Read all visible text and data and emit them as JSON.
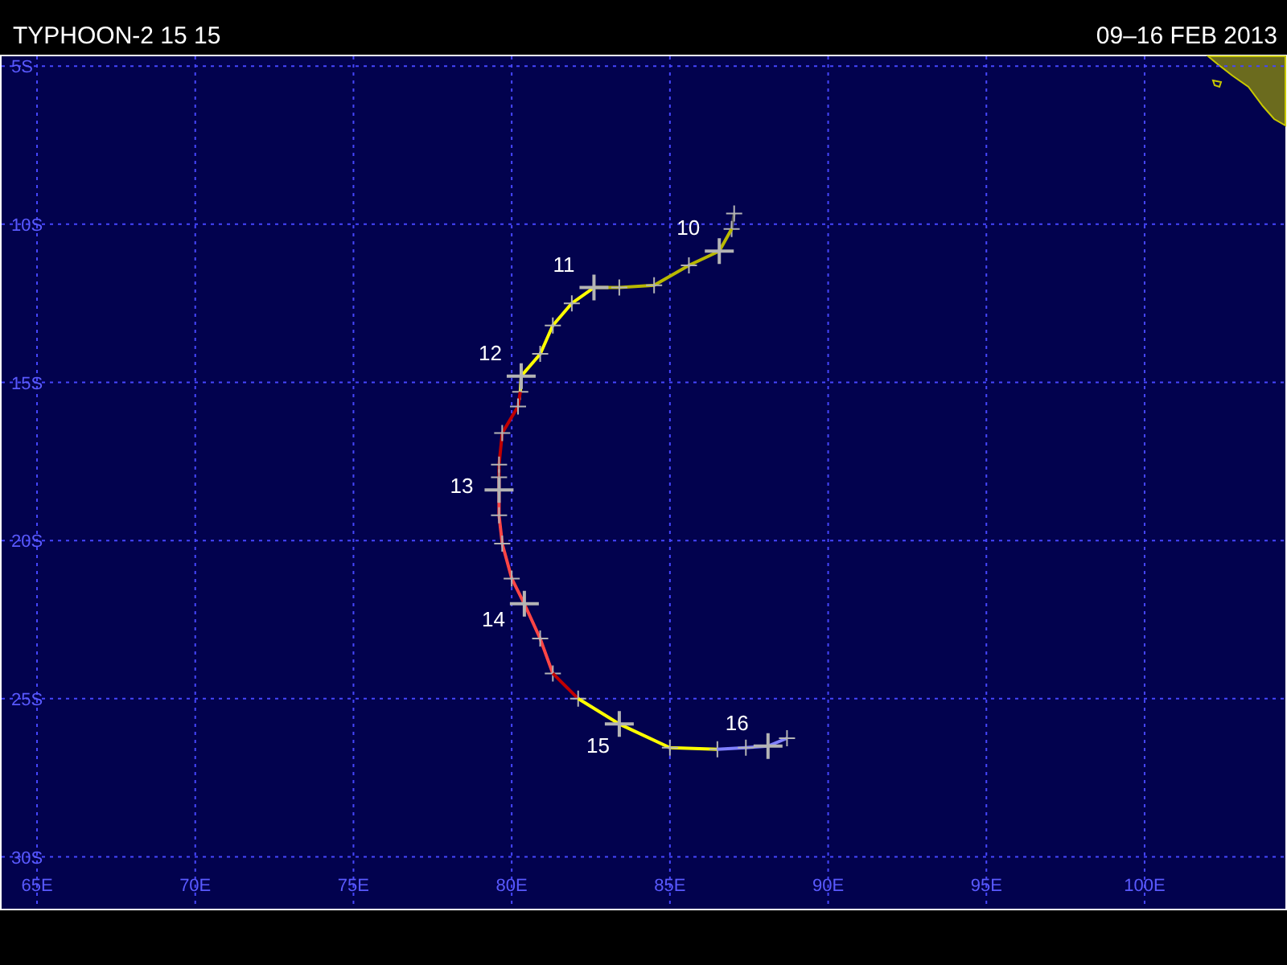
{
  "header": {
    "title": "TYPHOON-2 15 15",
    "date_range": "09–16 FEB 2013"
  },
  "map": {
    "chart_data": {
      "type": "line",
      "grid": true,
      "xlim": [
        63.83,
        104.5
      ],
      "ylim": [
        -31.69,
        -4.64
      ],
      "xticks": [
        {
          "value": 65,
          "label": "65E"
        },
        {
          "value": 70,
          "label": "70E"
        },
        {
          "value": 75,
          "label": "75E"
        },
        {
          "value": 80,
          "label": "80E"
        },
        {
          "value": 85,
          "label": "85E"
        },
        {
          "value": 90,
          "label": "90E"
        },
        {
          "value": 95,
          "label": "95E"
        },
        {
          "value": 100,
          "label": "100E"
        }
      ],
      "yticks": [
        {
          "value": -5,
          "label": "5S"
        },
        {
          "value": -10,
          "label": "10S"
        },
        {
          "value": -15,
          "label": "15S"
        },
        {
          "value": -20,
          "label": "20S"
        },
        {
          "value": -25,
          "label": "25S"
        },
        {
          "value": -30,
          "label": "30S"
        }
      ],
      "series": [
        {
          "color": "#505050",
          "marker": "cross",
          "x": [
            87.03,
            86.95
          ],
          "values": [
            -9.66,
            -10.15
          ]
        },
        {
          "color": "#b8b800",
          "marker": "cross",
          "x": [
            86.95,
            86.56,
            85.6,
            84.5,
            83.4,
            82.6
          ],
          "values": [
            -10.15,
            -10.85,
            -11.3,
            -11.93,
            -12.0,
            -12.0
          ]
        },
        {
          "color": "#ffff00",
          "marker": "cross",
          "x": [
            82.6,
            81.9,
            81.3,
            80.9,
            80.3,
            80.27
          ],
          "values": [
            -12.0,
            -12.5,
            -13.2,
            -14.1,
            -14.8,
            -15.3
          ]
        },
        {
          "color": "#c00000",
          "marker": "cross",
          "x": [
            80.27,
            80.2,
            79.7,
            79.6,
            79.6
          ],
          "values": [
            -15.3,
            -15.76,
            -16.6,
            -17.6,
            -18.0
          ]
        },
        {
          "color": "#ff4545",
          "marker": "cross",
          "x": [
            79.6,
            79.6,
            79.6,
            79.7,
            80.0,
            80.4,
            80.9,
            81.3
          ],
          "values": [
            -18.0,
            -18.4,
            -19.2,
            -20.1,
            -21.2,
            -22.0,
            -23.1,
            -24.2
          ]
        },
        {
          "color": "#c00000",
          "marker": "cross",
          "x": [
            81.3,
            82.1
          ],
          "values": [
            -24.2,
            -25.0
          ]
        },
        {
          "color": "#ffff00",
          "marker": "cross",
          "x": [
            82.1,
            83.4,
            85.0,
            86.5
          ],
          "values": [
            -25.0,
            -25.8,
            -26.55,
            -26.6
          ]
        },
        {
          "color": "#8080ff",
          "marker": "cross",
          "x": [
            86.5,
            87.4,
            88.1,
            88.7
          ],
          "values": [
            -26.6,
            -26.55,
            -26.5,
            -26.25
          ]
        }
      ],
      "annotations": [
        {
          "text": "10",
          "x": 86.56,
          "y": -10.85
        },
        {
          "text": "11",
          "x": 82.6,
          "y": -12.0
        },
        {
          "text": "12",
          "x": 80.3,
          "y": -14.8
        },
        {
          "text": "13",
          "x": 79.6,
          "y": -18.4
        },
        {
          "text": "14",
          "x": 80.4,
          "y": -22.0
        },
        {
          "text": "15",
          "x": 83.4,
          "y": -25.8
        },
        {
          "text": "16",
          "x": 88.1,
          "y": -26.5
        }
      ]
    }
  }
}
